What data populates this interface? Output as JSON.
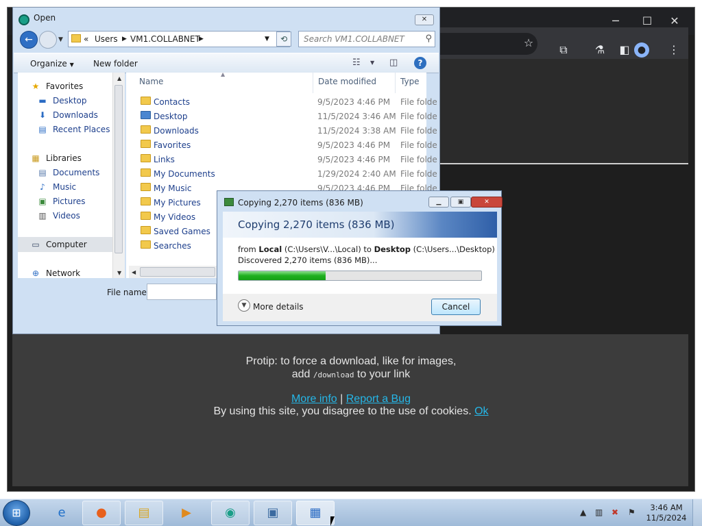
{
  "browser": {
    "minimize": "─",
    "maximize": "☐",
    "close": "✕",
    "toolbar_icons": [
      "star-icon",
      "extensions-icon",
      "flask-icon",
      "sidepanel-icon",
      "profile-icon",
      "menu-icon"
    ],
    "protip_line1": "Protip: to force a download, like for images,",
    "protip_add": "add ",
    "protip_code": "/download",
    "protip_tail": " to your link",
    "more_info": "More info",
    "separator": "|",
    "report_bug": "Report a Bug",
    "cookie_text": "By using this site, you disagree to the use of cookies.",
    "cookie_ok": "Ok",
    "link_color": "#25b7e8"
  },
  "open_dialog": {
    "title": "Open",
    "close": "✕",
    "address": {
      "chevrons": "«",
      "crumbs": [
        "Users",
        "VM1.COLLABNET"
      ]
    },
    "search_placeholder": "Search VM1.COLLABNET",
    "organize": "Organize",
    "new_folder": "New folder",
    "nav": {
      "favorites": "Favorites",
      "favorites_items": [
        "Desktop",
        "Downloads",
        "Recent Places"
      ],
      "libraries": "Libraries",
      "libraries_items": [
        "Documents",
        "Music",
        "Pictures",
        "Videos"
      ],
      "computer": "Computer",
      "network": "Network"
    },
    "columns": {
      "name": "Name",
      "date": "Date modified",
      "type": "Type"
    },
    "files": [
      {
        "name": "Contacts",
        "date": "9/5/2023 4:46 PM",
        "type": "File folder"
      },
      {
        "name": "Desktop",
        "date": "11/5/2024 3:46 AM",
        "type": "File folder"
      },
      {
        "name": "Downloads",
        "date": "11/5/2024 3:38 AM",
        "type": "File folder"
      },
      {
        "name": "Favorites",
        "date": "9/5/2023 4:46 PM",
        "type": "File folder"
      },
      {
        "name": "Links",
        "date": "9/5/2023 4:46 PM",
        "type": "File folder"
      },
      {
        "name": "My Documents",
        "date": "1/29/2024 2:40 AM",
        "type": "File folder"
      },
      {
        "name": "My Music",
        "date": "9/5/2023 4:46 PM",
        "type": "File folder"
      },
      {
        "name": "My Pictures",
        "date": "",
        "type": ""
      },
      {
        "name": "My Videos",
        "date": "",
        "type": ""
      },
      {
        "name": "Saved Games",
        "date": "",
        "type": ""
      },
      {
        "name": "Searches",
        "date": "",
        "type": ""
      }
    ],
    "filename_label": "File name:",
    "filename_value": ""
  },
  "copy_dialog": {
    "title": "Copying 2,270 items (836 MB)",
    "heading": "Copying 2,270 items (836 MB)",
    "from_prefix": "from ",
    "from_name": "Local",
    "from_path": " (C:\\Users\\V...\\Local)",
    "to_prefix": "  to ",
    "to_name": "Desktop",
    "to_path": " (C:\\Users...\\Desktop)",
    "discovered": "Discovered 2,270 items (836 MB)...",
    "progress_fraction": 0.36,
    "more_details": "More details",
    "cancel": "Cancel"
  },
  "taskbar": {
    "start_icon": "windows-start-icon",
    "apps": [
      "internet-explorer-icon",
      "firefox-icon",
      "file-explorer-icon",
      "media-player-icon",
      "remote-app-icon",
      "image-viewer-icon",
      "control-panel-icon"
    ],
    "clock_time": "3:46 AM",
    "clock_date": "11/5/2024"
  }
}
